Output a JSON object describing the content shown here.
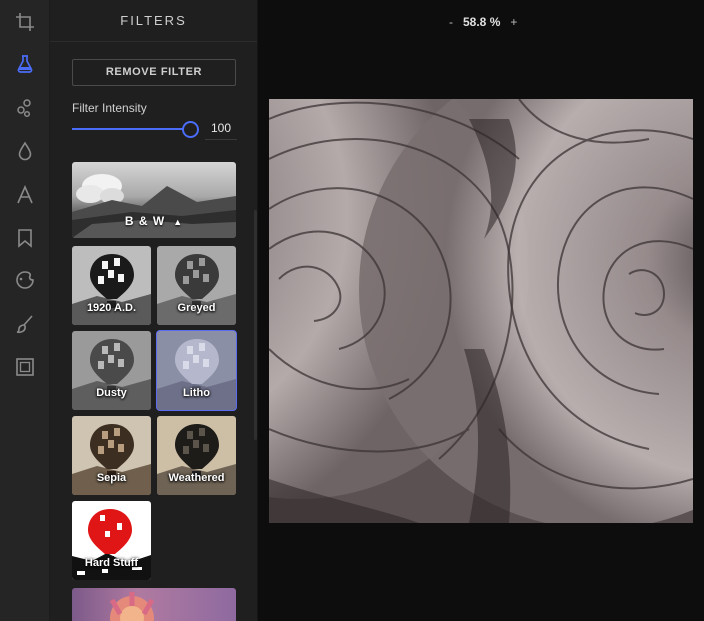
{
  "toolbar": {
    "tools": [
      {
        "icon": "crop-icon",
        "active": false
      },
      {
        "icon": "filter-flask-icon",
        "active": true
      },
      {
        "icon": "adjust-icon",
        "active": false
      },
      {
        "icon": "drop-icon",
        "active": false
      },
      {
        "icon": "text-icon",
        "active": false
      },
      {
        "icon": "bookmark-icon",
        "active": false
      },
      {
        "icon": "sticker-icon",
        "active": false
      },
      {
        "icon": "brush-icon",
        "active": false
      },
      {
        "icon": "frame-icon",
        "active": false
      }
    ]
  },
  "panel": {
    "title": "FILTERS",
    "remove_label": "REMOVE FILTER",
    "intensity_label": "Filter Intensity",
    "intensity_value": "100",
    "intensity_level": 1.0,
    "group": {
      "label": "B & W",
      "caret": "▲"
    },
    "filters": [
      {
        "label": "1920 A.D.",
        "selected": false
      },
      {
        "label": "Greyed",
        "selected": false
      },
      {
        "label": "Dusty",
        "selected": false
      },
      {
        "label": "Litho",
        "selected": true
      },
      {
        "label": "Sepia",
        "selected": false
      },
      {
        "label": "Weathered",
        "selected": false
      },
      {
        "label": "Hard Stuff",
        "selected": false
      }
    ]
  },
  "canvas": {
    "zoom_minus": "-",
    "zoom_value": "58.8 %",
    "zoom_plus": "+"
  },
  "colors": {
    "accent": "#4a6cf7",
    "panel_bg": "#1f1f1f",
    "toolbar_bg": "#252525",
    "canvas_bg": "#0d0d0d"
  }
}
